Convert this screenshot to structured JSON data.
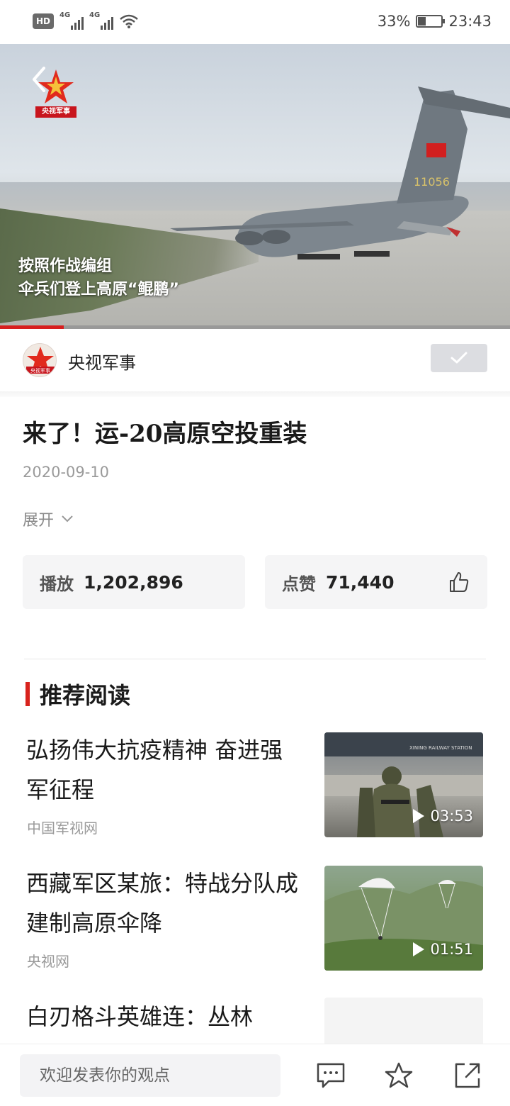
{
  "status_bar": {
    "hd": "HD",
    "hd_sub": "2",
    "net1": "4G",
    "net2": "4G",
    "battery_percent": "33%",
    "battery_level": 0.33,
    "time": "23:43"
  },
  "video": {
    "logo_text": "央视军事",
    "caption_line1": "按照作战编组",
    "caption_line2": "伞兵们登上高原“鲲鹏”",
    "tail_number": "11056",
    "progress_fraction": 0.125
  },
  "channel": {
    "avatar_text": "央视军事",
    "name": "央视军事",
    "follow_state": "followed"
  },
  "article": {
    "title": "来了！运-20高原空投重装",
    "date": "2020-09-10",
    "expand_label": "展开"
  },
  "stats": {
    "play_label": "播放",
    "play_count": "1,202,896",
    "like_label": "点赞",
    "like_count": "71,440"
  },
  "recommend": {
    "heading": "推荐阅读",
    "items": [
      {
        "title": "弘扬伟大抗疫精神 奋进强军征程",
        "source": "中国军视网",
        "duration": "03:53",
        "thumb_sign": "XINING RAILWAY STATION"
      },
      {
        "title": "西藏军区某旅：特战分队成建制高原伞降",
        "source": "央视网",
        "duration": "01:51"
      },
      {
        "title": "白刃格斗英雄连：丛林"
      }
    ]
  },
  "bottom_bar": {
    "comment_placeholder": "欢迎发表你的观点",
    "icons": [
      "comment-icon",
      "star-icon",
      "share-icon"
    ]
  },
  "colors": {
    "accent_red": "#d8231d",
    "stat_bg": "#f5f5f6",
    "follow_bg": "#dcdde1"
  }
}
